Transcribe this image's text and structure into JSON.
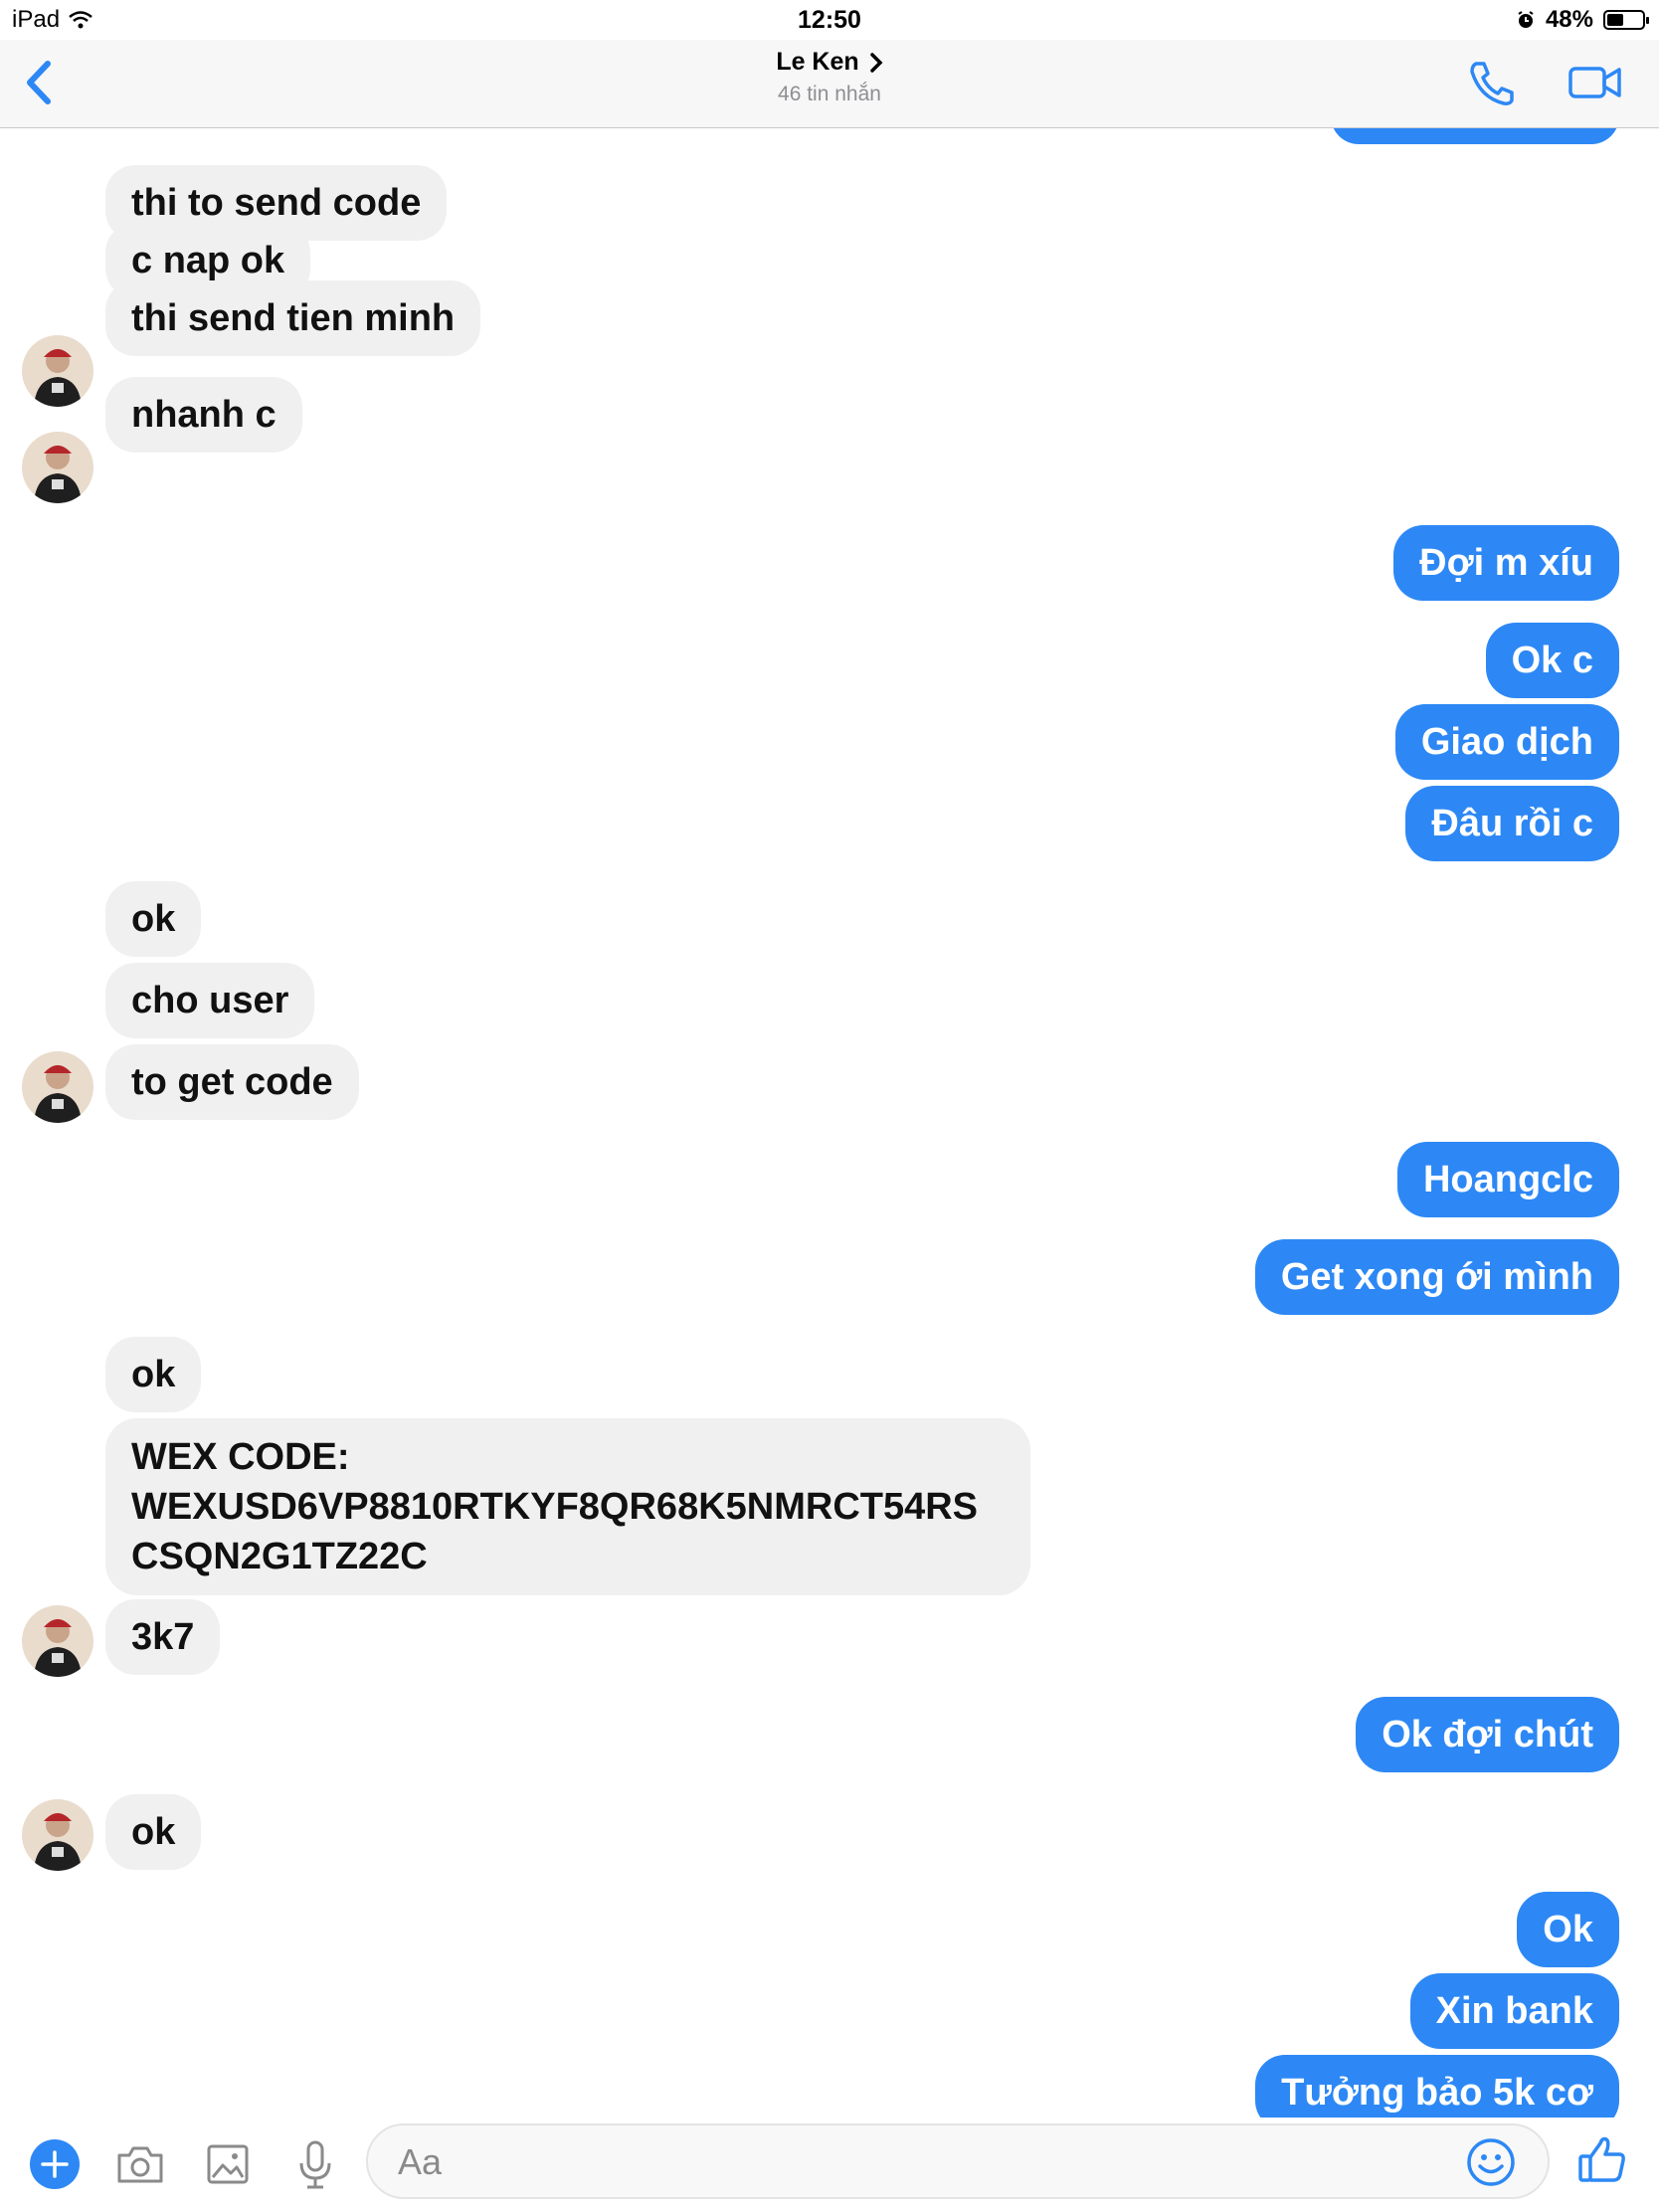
{
  "status_bar": {
    "device": "iPad",
    "time": "12:50",
    "battery": "48%",
    "battery_level": 0.48
  },
  "header": {
    "name": "Le Ken",
    "subtitle": "46 tin nhắn",
    "accent_color": "#2d88f5"
  },
  "messages": [
    "thi to send code",
    "c nap ok",
    "thi send tien minh",
    "nhanh c",
    "Đợi m xíu",
    "Ok c",
    "Giao dịch",
    "Đâu rồi c",
    "ok",
    "cho user",
    "to get code",
    "Hoangclc",
    "Get xong ới mình",
    "ok",
    "WEX CODE:\nWEXUSD6VP8810RTKYF8QR68K5NMRCT54RS\nCSQN2G1TZ22C",
    "3k7",
    "Ok đợi chút",
    "ok",
    "Ok",
    "Xin bank",
    "Tưởng bảo 5k cơ"
  ],
  "composer": {
    "placeholder": "Aa"
  },
  "icons": [
    "wifi-icon",
    "alarm-icon",
    "back-icon",
    "chevron-right-icon",
    "phone-icon",
    "video-icon",
    "plus-icon",
    "camera-icon",
    "image-icon",
    "microphone-icon",
    "emoji-icon",
    "thumbs-up-icon"
  ]
}
